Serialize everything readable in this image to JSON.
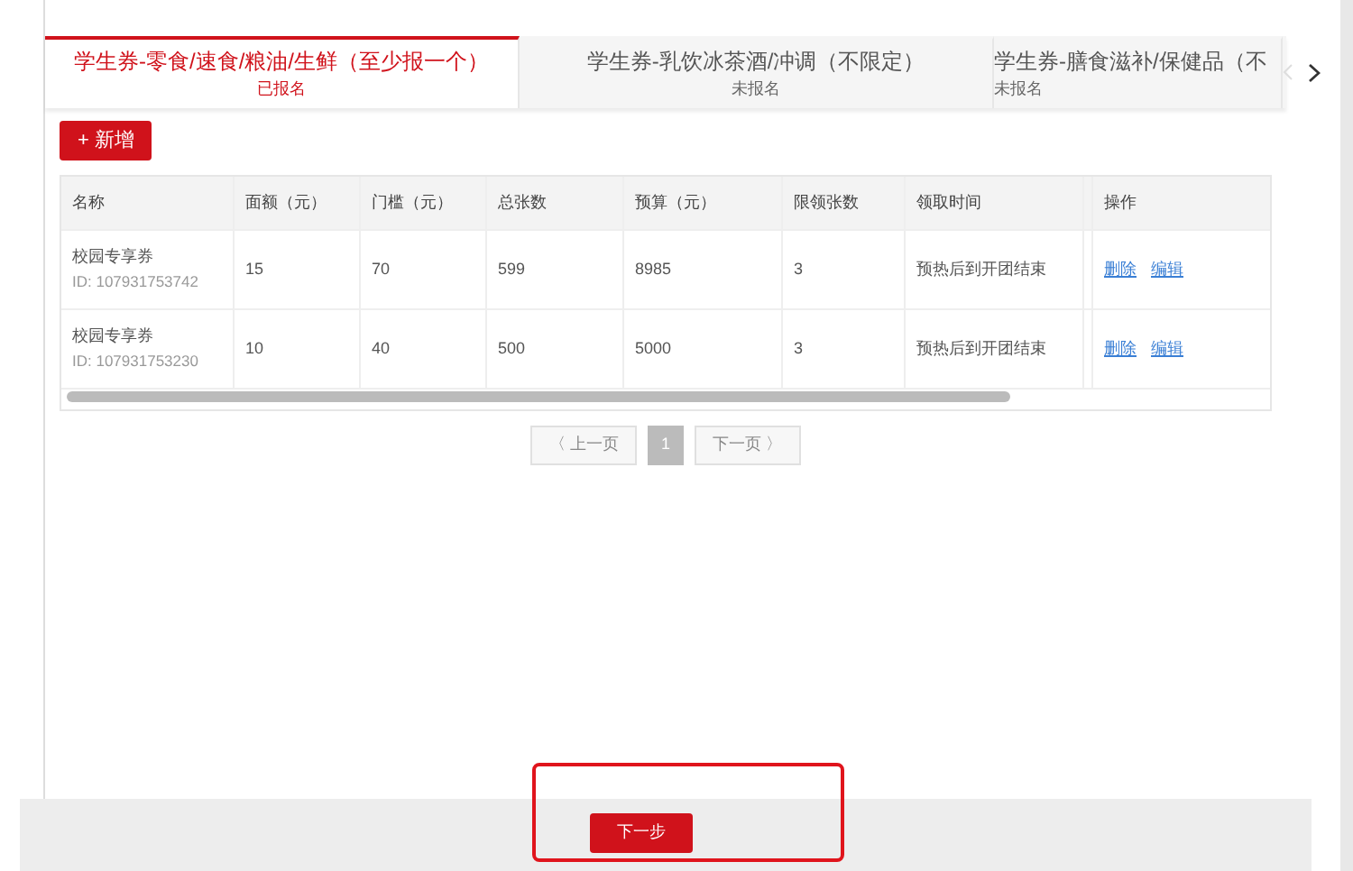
{
  "tabs": [
    {
      "title": "学生券-零食/速食/粮油/生鲜（至少报一个）",
      "status": "已报名",
      "selected": true
    },
    {
      "title": "学生券-乳饮冰茶酒/冲调（不限定）",
      "status": "未报名",
      "selected": false
    },
    {
      "title": "学生券-膳食滋补/保健品（不",
      "status": "未报名",
      "selected": false
    }
  ],
  "add_button": {
    "icon": "+",
    "label": "新增"
  },
  "table": {
    "columns": [
      "名称",
      "面额（元）",
      "门槛（元）",
      "总张数",
      "预算（元）",
      "限领张数",
      "领取时间",
      "操作"
    ],
    "rows": [
      {
        "id": "ID: 107931753742",
        "cells": [
          "校园专享券",
          "15",
          "70",
          "599",
          "8985",
          "3",
          "预热后到开团结束"
        ],
        "actions": [
          "删除",
          "编辑"
        ]
      },
      {
        "id": "ID: 107931753230",
        "cells": [
          "校园专享券",
          "10",
          "40",
          "500",
          "5000",
          "3",
          "预热后到开团结束"
        ],
        "actions": [
          "删除",
          "编辑"
        ]
      }
    ]
  },
  "pagination": {
    "prev": "〈 上一页",
    "pages": [
      {
        "label": "1",
        "selected": true
      }
    ],
    "next": "下一页 〉",
    "prev_disabled": true,
    "next_disabled": true
  },
  "footer": {
    "next_step": "下一步",
    "highlighted": true
  }
}
